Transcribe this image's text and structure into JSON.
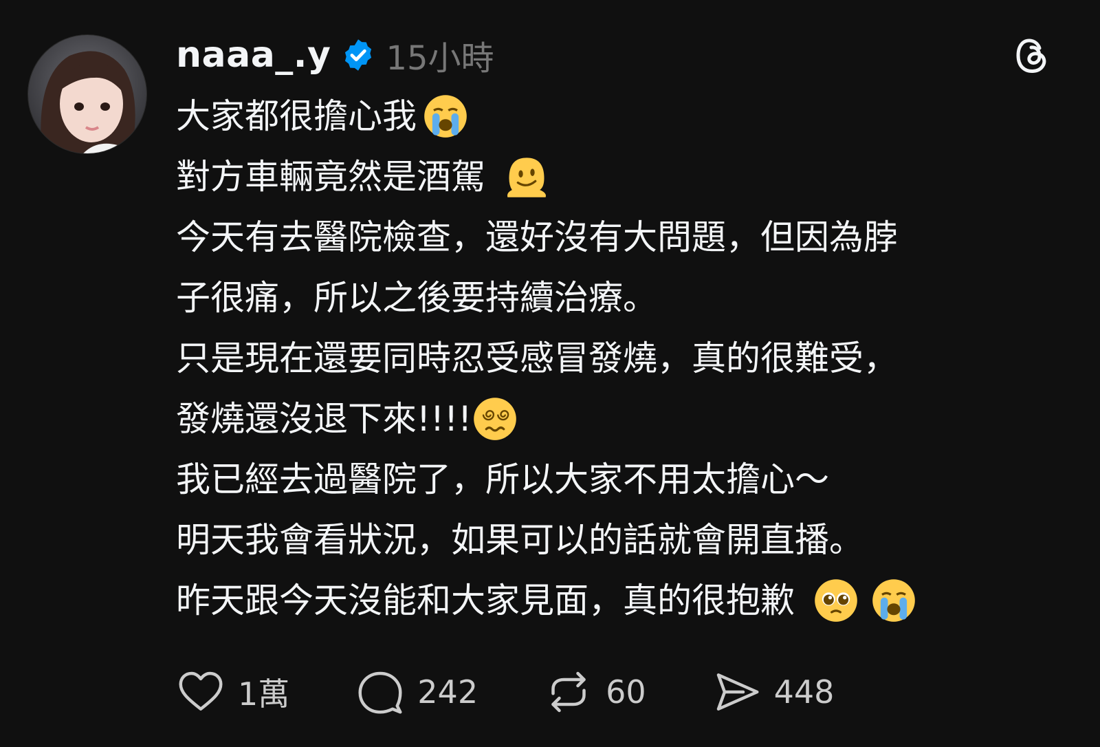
{
  "post": {
    "username": "naaa_.y",
    "timestamp": "15小時",
    "lines": [
      "大家都很擔心我",
      "對方車輛竟然是酒駕",
      "今天有去醫院檢查，還好沒有大問題，但因為脖",
      "子很痛，所以之後要持續治療。",
      "只是現在還要同時忍受感冒發燒，真的很難受，",
      "發燒還沒退下來!!!!",
      "我已經去過醫院了，所以大家不用太擔心～",
      "明天我會看狀況，如果可以的話就會開直播。",
      "昨天跟今天沒能和大家見面，真的很抱歉"
    ]
  },
  "actions": {
    "likes": "1萬",
    "comments": "242",
    "reposts": "60",
    "shares": "448"
  },
  "icons": {
    "verified": "verified-badge-icon",
    "logo": "threads-logo-icon",
    "like": "heart-icon",
    "comment": "comment-bubble-icon",
    "repost": "repost-icon",
    "share": "send-icon"
  },
  "colors": {
    "background": "#101010",
    "text": "#f3f5f7",
    "muted": "#777777",
    "verified": "#0095f6"
  }
}
